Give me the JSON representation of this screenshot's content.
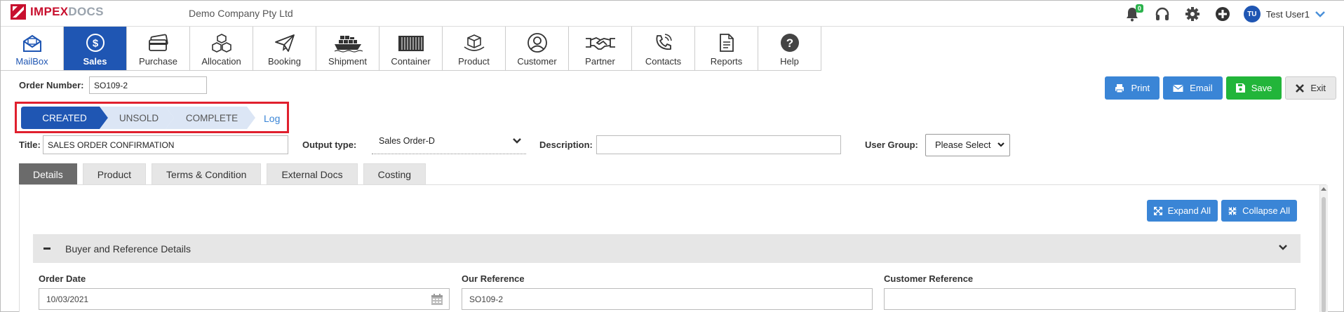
{
  "app": {
    "logo_part1": "IMPEX",
    "logo_part2": "DOCS",
    "company": "Demo Company Pty Ltd",
    "notification_count": "0",
    "user_initials": "TU",
    "user_name": "Test User1"
  },
  "modules": [
    {
      "label": "MailBox",
      "icon": "mailbox-icon"
    },
    {
      "label": "Sales",
      "icon": "dollar-circle-icon"
    },
    {
      "label": "Purchase",
      "icon": "credit-card-icon"
    },
    {
      "label": "Allocation",
      "icon": "boxes-icon"
    },
    {
      "label": "Booking",
      "icon": "paper-plane-icon"
    },
    {
      "label": "Shipment",
      "icon": "ship-icon"
    },
    {
      "label": "Container",
      "icon": "container-icon"
    },
    {
      "label": "Product",
      "icon": "box-icon"
    },
    {
      "label": "Customer",
      "icon": "user-icon"
    },
    {
      "label": "Partner",
      "icon": "handshake-icon"
    },
    {
      "label": "Contacts",
      "icon": "phone-icon"
    },
    {
      "label": "Reports",
      "icon": "document-icon"
    },
    {
      "label": "Help",
      "icon": "question-icon"
    }
  ],
  "order": {
    "number_label": "Order Number:",
    "number_value": "SO109-2",
    "title_label": "Title:",
    "title_value": "SALES ORDER CONFIRMATION",
    "output_type_label": "Output type:",
    "output_type_value": "Sales Order-D",
    "description_label": "Description:",
    "description_value": "",
    "user_group_label": "User Group:",
    "user_group_value": "Please Select"
  },
  "actions": {
    "print": "Print",
    "email": "Email",
    "save": "Save",
    "exit": "Exit"
  },
  "status": {
    "steps": [
      "CREATED",
      "UNSOLD",
      "COMPLETE"
    ],
    "active_index": 0,
    "log": "Log"
  },
  "tabs": [
    "Details",
    "Product",
    "Terms & Condition",
    "External Docs",
    "Costing"
  ],
  "details": {
    "expand_all": "Expand All",
    "collapse_all": "Collapse All",
    "section_title": "Buyer and Reference Details",
    "order_date_label": "Order Date",
    "order_date_value": "10/03/2021",
    "our_reference_label": "Our Reference",
    "our_reference_value": "SO109-2",
    "customer_reference_label": "Customer Reference",
    "customer_reference_value": ""
  },
  "colors": {
    "primary": "#1f56b3",
    "button_blue": "#3a85d6",
    "button_green": "#22b53a",
    "highlight_red": "#e0202e",
    "step_inactive": "#dce6f5"
  }
}
